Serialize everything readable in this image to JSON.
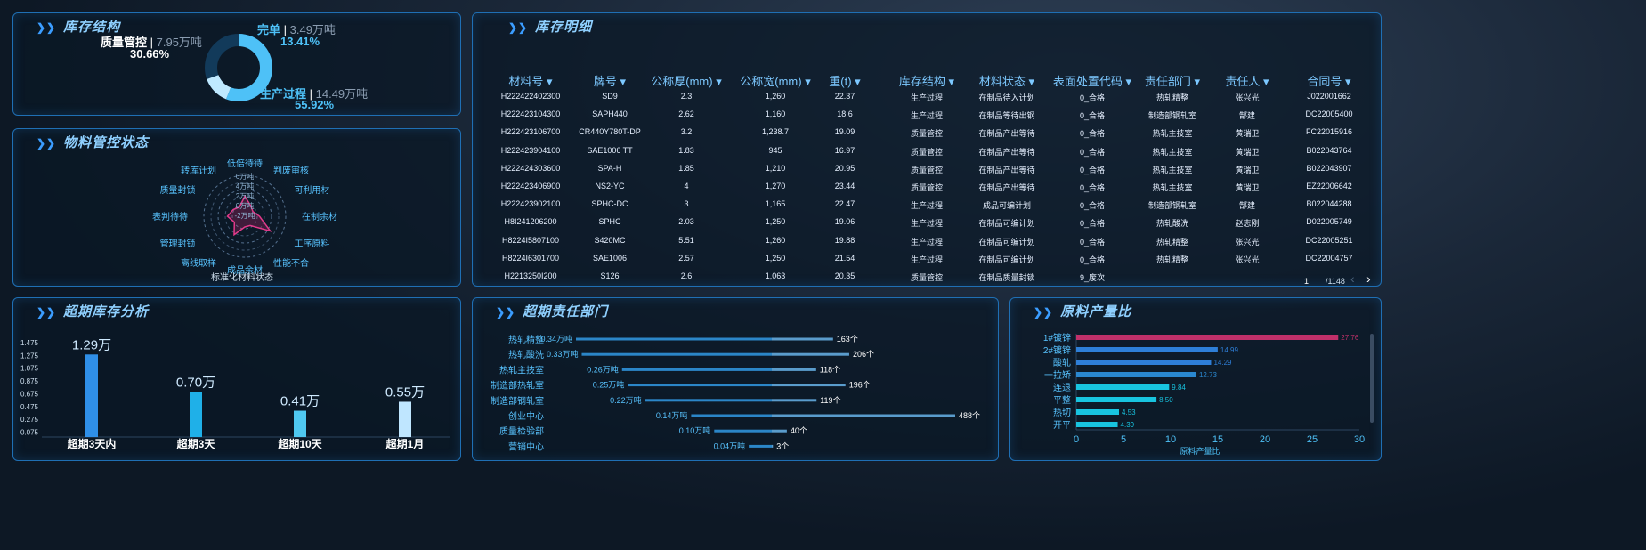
{
  "structure": {
    "title": "库存结构",
    "items": [
      {
        "label": "质量管控",
        "value": "7.95万吨",
        "pct": "30.66%"
      },
      {
        "label": "完单",
        "value": "3.49万吨",
        "pct": "13.41%"
      },
      {
        "label": "生产过程",
        "value": "14.49万吨",
        "pct": "55.92%"
      }
    ],
    "donut": [
      30.66,
      13.41,
      55.92
    ]
  },
  "material": {
    "title": "物料管控状态",
    "caption": "标准化材料状态",
    "labels": [
      "低倍待待",
      "判废审核",
      "可利用材",
      "在制余材",
      "工序原料",
      "性能不合",
      "成品余材",
      "离线取样",
      "管理封锁",
      "表判待待",
      "质量封锁",
      "转库计划"
    ],
    "rings": [
      "6万吨",
      "4万吨",
      "2万吨",
      "0万吨",
      "-2万吨"
    ]
  },
  "overdue": {
    "title": "超期库存分析",
    "ylabels": [
      "1.475",
      "1.275",
      "1.075",
      "0.875",
      "0.675",
      "0.475",
      "0.275",
      "0.075"
    ],
    "bars": [
      {
        "label": "超期3天内",
        "value": "1.29万",
        "v": 1.29
      },
      {
        "label": "超期3天",
        "value": "0.70万",
        "v": 0.7
      },
      {
        "label": "超期10天",
        "value": "0.41万",
        "v": 0.41
      },
      {
        "label": "超期1月",
        "value": "0.55万",
        "v": 0.55
      }
    ]
  },
  "detail": {
    "title": "库存明细",
    "headers": [
      "材料号",
      "牌号",
      "公称厚(mm)",
      "公称宽(mm)",
      "重(t)",
      "库存结构",
      "材料状态",
      "表面处置代码",
      "责任部门",
      "责任人",
      "合同号"
    ],
    "rows": [
      [
        "H222422402300",
        "SD9",
        "2.3",
        "1,260",
        "22.37",
        "生产过程",
        "在制品待入计划",
        "0_合格",
        "热轧精整",
        "张兴光",
        "J022001662"
      ],
      [
        "H222423104300",
        "SAPH440",
        "2.62",
        "1,160",
        "18.6",
        "生产过程",
        "在制品等待出钢",
        "0_合格",
        "制造部钢轧室",
        "郜建",
        "DC22005400"
      ],
      [
        "H222423106700",
        "CR440Y780T-DP",
        "3.2",
        "1,238.7",
        "19.09",
        "质量管控",
        "在制品产出等待",
        "0_合格",
        "热轧主技室",
        "黄瑞卫",
        "FC22015916"
      ],
      [
        "H222423904100",
        "SAE1006 TT",
        "1.83",
        "945",
        "16.97",
        "质量管控",
        "在制品产出等待",
        "0_合格",
        "热轧主技室",
        "黄瑞卫",
        "B022043764"
      ],
      [
        "H222424303600",
        "SPA-H",
        "1.85",
        "1,210",
        "20.95",
        "质量管控",
        "在制品产出等待",
        "0_合格",
        "热轧主技室",
        "黄瑞卫",
        "B022043907"
      ],
      [
        "H222423406900",
        "NS2-YC",
        "4",
        "1,270",
        "23.44",
        "质量管控",
        "在制品产出等待",
        "0_合格",
        "热轧主技室",
        "黄瑞卫",
        "EZ22006642"
      ],
      [
        "H222423902100",
        "SPHC-DC",
        "3",
        "1,165",
        "22.47",
        "生产过程",
        "成品可编计划",
        "0_合格",
        "制造部钢轧室",
        "郜建",
        "B022044288"
      ],
      [
        "H8I241206200",
        "SPHC",
        "2.03",
        "1,250",
        "19.06",
        "生产过程",
        "在制品可编计划",
        "0_合格",
        "热轧酸洗",
        "赵志刚",
        "D022005749"
      ],
      [
        "H8224I5807100",
        "S420MC",
        "5.51",
        "1,260",
        "19.88",
        "生产过程",
        "在制品可编计划",
        "0_合格",
        "热轧精整",
        "张兴光",
        "DC22005251"
      ],
      [
        "H8224I6301700",
        "SAE1006",
        "2.57",
        "1,250",
        "21.54",
        "生产过程",
        "在制品可编计划",
        "0_合格",
        "热轧精整",
        "张兴光",
        "DC22004757"
      ],
      [
        "H2213250I200",
        "S126",
        "2.6",
        "1,063",
        "20.35",
        "质量管控",
        "在制品质量封锁",
        "9_废次",
        null,
        null,
        null
      ]
    ],
    "page": "1",
    "total": "/1148"
  },
  "dept": {
    "title": "超期责任部门",
    "rows": [
      {
        "name": "热轧精整",
        "weight": "0.34万吨",
        "count": "163个",
        "w": 0.34,
        "c": 163
      },
      {
        "name": "热轧酸洗",
        "weight": "0.33万吨",
        "count": "206个",
        "w": 0.33,
        "c": 206
      },
      {
        "name": "热轧主技室",
        "weight": "0.26万吨",
        "count": "118个",
        "w": 0.26,
        "c": 118
      },
      {
        "name": "制造部热轧室",
        "weight": "0.25万吨",
        "count": "196个",
        "w": 0.25,
        "c": 196
      },
      {
        "name": "制造部钢轧室",
        "weight": "0.22万吨",
        "count": "119个",
        "w": 0.22,
        "c": 119
      },
      {
        "name": "创业中心",
        "weight": "0.14万吨",
        "count": "488个",
        "w": 0.14,
        "c": 488
      },
      {
        "name": "质量检验部",
        "weight": "0.10万吨",
        "count": "40个",
        "w": 0.1,
        "c": 40
      },
      {
        "name": "营销中心",
        "weight": "0.04万吨",
        "count": "3个",
        "w": 0.04,
        "c": 3
      }
    ]
  },
  "ratio": {
    "title": "原料产量比",
    "xlabel": "原料产量比",
    "xticks": [
      "0",
      "5",
      "10",
      "15",
      "20",
      "25",
      "30"
    ],
    "rows": [
      {
        "name": "1#镀锌",
        "v": 27.76,
        "label": "27.76",
        "color": "#c0306a"
      },
      {
        "name": "2#镀锌",
        "v": 14.99,
        "label": "14.99",
        "color": "#2e7fd8"
      },
      {
        "name": "酸轧",
        "v": 14.29,
        "label": "14.29",
        "color": "#2e7fd8"
      },
      {
        "name": "一拉矫",
        "v": 12.73,
        "label": "12.73",
        "color": "#2a88d0"
      },
      {
        "name": "连退",
        "v": 9.84,
        "label": "9.84",
        "color": "#18c4e0"
      },
      {
        "name": "平整",
        "v": 8.5,
        "label": "8.50",
        "color": "#18c4e0"
      },
      {
        "name": "热切",
        "v": 4.53,
        "label": "4.53",
        "color": "#18c4e0"
      },
      {
        "name": "开平",
        "v": 4.39,
        "label": "4.39",
        "color": "#18c4e0"
      }
    ]
  }
}
